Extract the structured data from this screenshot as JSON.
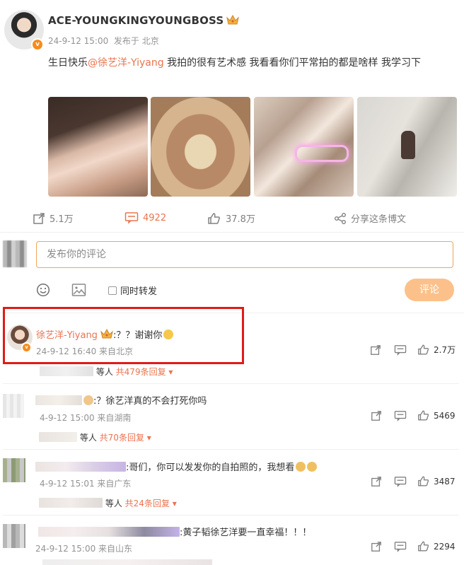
{
  "post": {
    "username": "ACE-YOUNGKINGYOUNGBOSS",
    "date": "24-9-12 15:00",
    "source": "发布于 北京",
    "text_prefix": "生日快乐",
    "mention": "@徐艺洋-Yiyang",
    "text_suffix": " 我拍的很有艺术感  我看看你们平常拍的都是啥样 我学习下",
    "photos": [
      "photo-1",
      "photo-2",
      "photo-3",
      "photo-4"
    ]
  },
  "actions": {
    "repost_count": "5.1万",
    "comment_count": "4922",
    "like_count": "37.8万",
    "share_label": "分享这条博文"
  },
  "comment_box": {
    "placeholder": "发布你的评论",
    "repost_checkbox_label": "同时转发",
    "submit_label": "评论"
  },
  "comments": [
    {
      "name": "徐艺洋-Yiyang",
      "text": ":？？谢谢你",
      "time": "24-9-12 16:40 来自北京",
      "likes": "2.7万",
      "replies_prefix": "等人",
      "replies_count": "共479条回复"
    },
    {
      "name": "",
      "text": ":？徐艺洋真的不会打死你吗",
      "time": "4-9-12 15:00 来自湖南",
      "likes": "5469",
      "replies_prefix": "等人",
      "replies_count": "共70条回复"
    },
    {
      "name": "",
      "text": ":哥们，你可以发发你的自拍照的，我想看",
      "time": "4-9-12 15:01 来自广东",
      "likes": "3487",
      "replies_prefix": "等人",
      "replies_count": "共24条回复"
    },
    {
      "name": "",
      "text": ":黄子韬徐艺洋要一直幸福！！！",
      "time": "24-9-12 15:00 来自山东",
      "likes": "2294"
    }
  ],
  "colors": {
    "accent": "#eb7350",
    "submit_bg": "#fcc18a",
    "highlight": "#e11a1a",
    "input_border": "#f2a55a"
  }
}
